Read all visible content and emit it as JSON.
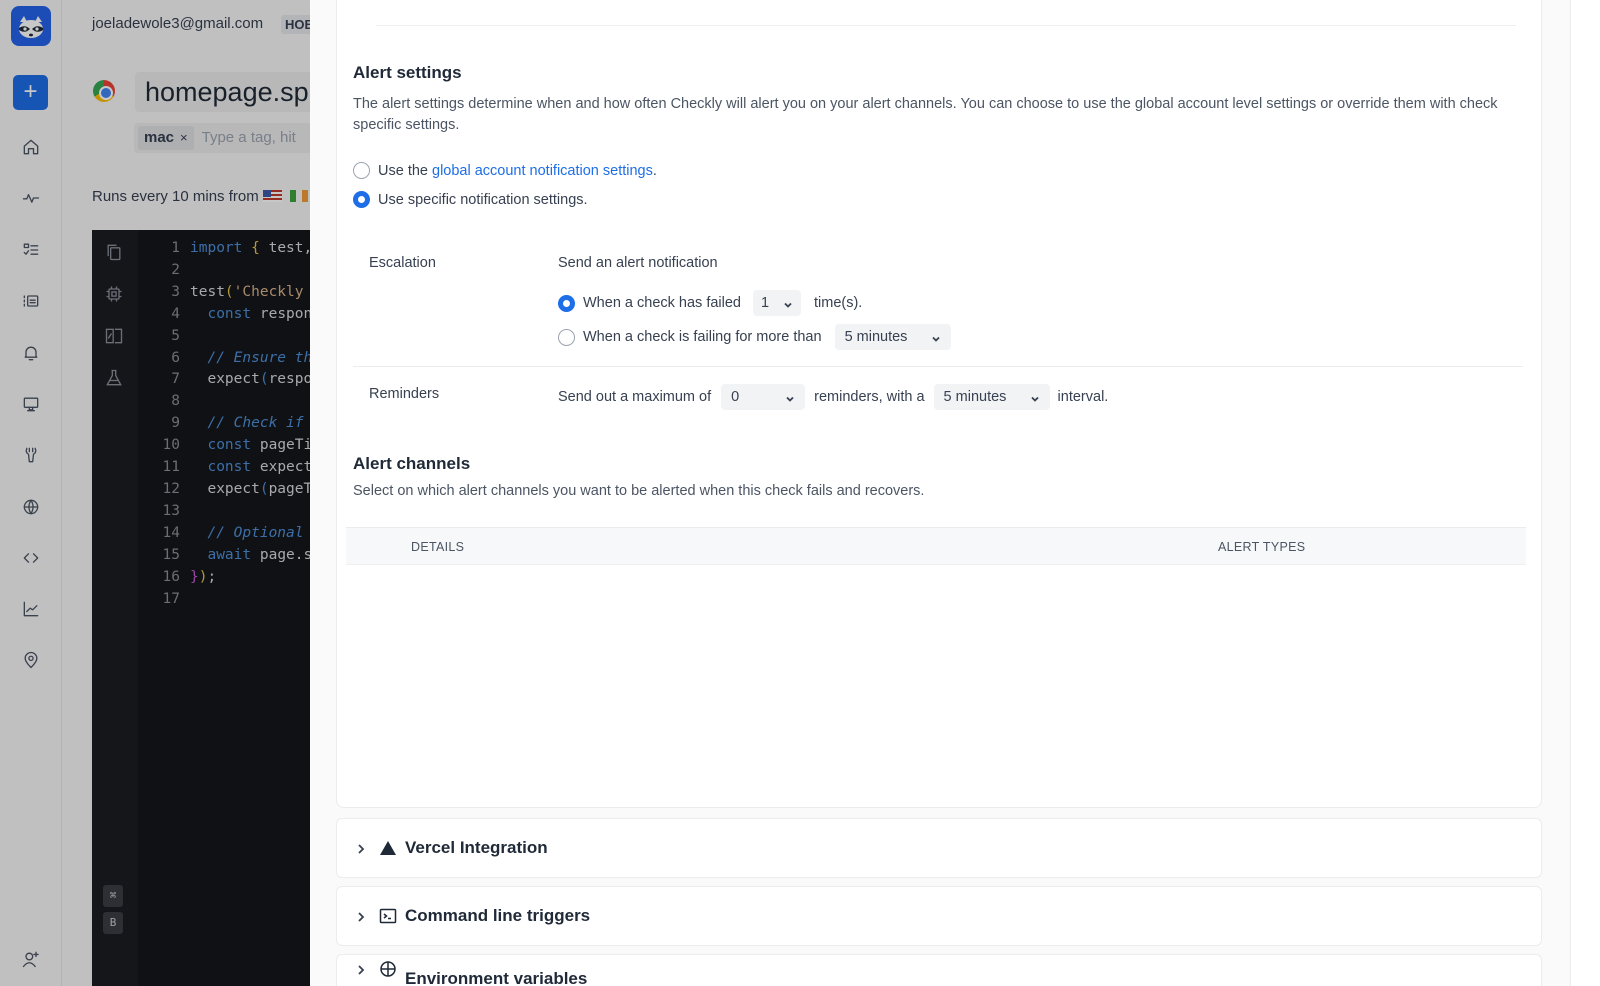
{
  "background": {
    "user_email": "joeladewole3@gmail.com",
    "plan_badge": "HOB",
    "check_name": "homepage.sp",
    "tags": [
      {
        "label": "mac",
        "remove": "×"
      }
    ],
    "tag_placeholder": "Type a tag, hit",
    "runs_text": "Runs every 10 mins from",
    "new_button": "+",
    "rail_icons": [
      "home-icon",
      "activity-icon",
      "checklist-icon",
      "list-icon",
      "bell-icon",
      "monitor-icon",
      "tools-icon",
      "globe-icon",
      "code-icon",
      "chart-icon",
      "location-pin-icon",
      "add-user-icon"
    ],
    "editor": {
      "kbd_keys": [
        "⌘",
        "B"
      ],
      "lines": [
        {
          "n": "1",
          "parts": [
            [
              "kw",
              "import"
            ],
            [
              "tx",
              " "
            ],
            [
              "br",
              "{"
            ],
            [
              "tx",
              " test,"
            ]
          ]
        },
        {
          "n": "2",
          "parts": []
        },
        {
          "n": "3",
          "parts": [
            [
              "tx",
              "test"
            ],
            [
              "br",
              "("
            ],
            [
              "str",
              "'Checkly"
            ]
          ]
        },
        {
          "n": "4",
          "parts": [
            [
              "tx",
              "  "
            ],
            [
              "kw",
              "const"
            ],
            [
              "tx",
              " respon"
            ]
          ]
        },
        {
          "n": "5",
          "parts": []
        },
        {
          "n": "6",
          "parts": [
            [
              "tx",
              "  "
            ],
            [
              "cm",
              "// Ensure th"
            ]
          ]
        },
        {
          "n": "7",
          "parts": [
            [
              "tx",
              "  expect"
            ],
            [
              "kw",
              "("
            ],
            [
              "tx",
              "respo"
            ]
          ]
        },
        {
          "n": "8",
          "parts": []
        },
        {
          "n": "9",
          "parts": [
            [
              "tx",
              "  "
            ],
            [
              "cm",
              "// Check if"
            ]
          ]
        },
        {
          "n": "10",
          "parts": [
            [
              "tx",
              "  "
            ],
            [
              "kw",
              "const"
            ],
            [
              "tx",
              " pageTi"
            ]
          ]
        },
        {
          "n": "11",
          "parts": [
            [
              "tx",
              "  "
            ],
            [
              "kw",
              "const"
            ],
            [
              "tx",
              " expect"
            ]
          ]
        },
        {
          "n": "12",
          "parts": [
            [
              "tx",
              "  expect"
            ],
            [
              "kw",
              "("
            ],
            [
              "tx",
              "pageT"
            ]
          ]
        },
        {
          "n": "13",
          "parts": []
        },
        {
          "n": "14",
          "parts": [
            [
              "tx",
              "  "
            ],
            [
              "cm",
              "// Optional"
            ]
          ]
        },
        {
          "n": "15",
          "parts": [
            [
              "tx",
              "  "
            ],
            [
              "kw",
              "await"
            ],
            [
              "tx",
              " page.s"
            ]
          ]
        },
        {
          "n": "16",
          "parts": [
            [
              "br2",
              "}"
            ],
            [
              "br",
              ")"
            ],
            [
              "tx",
              ";"
            ]
          ]
        },
        {
          "n": "17",
          "parts": []
        }
      ]
    }
  },
  "alert_settings": {
    "title": "Alert settings",
    "description": "The alert settings determine when and how often Checkly will alert you on your alert channels. You can choose to use the global account level settings or override them with check specific settings.",
    "options": [
      {
        "prefix": "Use the ",
        "link": "global account notification settings",
        "suffix": ".",
        "checked": false
      },
      {
        "prefix": "Use specific notification settings.",
        "link": "",
        "suffix": "",
        "checked": true
      }
    ],
    "escalation": {
      "label": "Escalation",
      "heading": "Send an alert notification",
      "option_failed": {
        "text": "When a check has failed",
        "value": "1",
        "suffix": "time(s).",
        "checked": true
      },
      "option_failing": {
        "text": "When a check is failing for more than",
        "value": "5 minutes",
        "checked": false
      }
    },
    "reminders": {
      "label": "Reminders",
      "prefix": "Send out a maximum of",
      "count": "0",
      "middle": "reminders, with a",
      "interval": "5 minutes",
      "suffix": "interval."
    }
  },
  "alert_channels": {
    "title": "Alert channels",
    "description": "Select on which alert channels you want to be alerted when this check fails and recovers.",
    "columns": [
      "DETAILS",
      "ALERT TYPES"
    ]
  },
  "accordions": [
    {
      "title": "Vercel Integration",
      "icon": "vercel-triangle-icon"
    },
    {
      "title": "Command line triggers",
      "icon": "terminal-icon"
    },
    {
      "title": "Environment variables",
      "icon": "globe-icon"
    }
  ],
  "colors": {
    "accent": "#1e6ee8",
    "logo_bg": "#2563eb"
  }
}
